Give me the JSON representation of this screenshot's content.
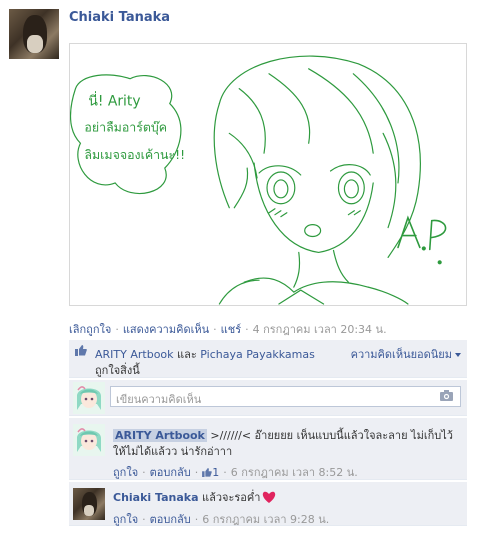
{
  "post": {
    "author": "Chiaki Tanaka",
    "image_text": {
      "line1": "นี่! Arity",
      "line2": "อย่าลืมอาร์ตบุ๊ค",
      "line3": "ลิมเมจจองเค้านะ!!",
      "signature": "A.P."
    },
    "actions": {
      "unlike": "เลิกถูกใจ",
      "comment": "แสดงความคิดเห็น",
      "share": "แชร์",
      "timestamp": "4 กรกฎาคม เวลา 20:34 น."
    }
  },
  "likes": {
    "name1": "ARITY Artbook",
    "and": "และ",
    "name2": "Pichaya Payakkamas",
    "suffix": "ถูกใจสิ่งนี้",
    "top_comments": "ความคิดเห็นยอดนิยม"
  },
  "compose": {
    "placeholder": "เขียนความคิดเห็น"
  },
  "comments": [
    {
      "author": "ARITY Artbook",
      "text": " >//////< อ๊ายยยย เห็นแบบนี้แล้วใจละลาย ไม่เก็บไว้ให้ไม่ได้แล้วว น่ารักอ่าาา",
      "like": "ถูกใจ",
      "reply": "ตอบกลับ",
      "like_count": "1",
      "timestamp": "6 กรกฎาคม เวลา 8:52 น."
    },
    {
      "author": "Chiaki Tanaka",
      "text": " แล้วจะรอค่ำ",
      "like": "ถูกใจ",
      "reply": "ตอบกลับ",
      "timestamp": "6 กรกฎาคม เวลา 9:28 น."
    }
  ],
  "colors": {
    "link": "#3b5998",
    "ufi_bg": "#edeff4",
    "sketch": "#2e9a3e",
    "heart": "#e0245e"
  }
}
